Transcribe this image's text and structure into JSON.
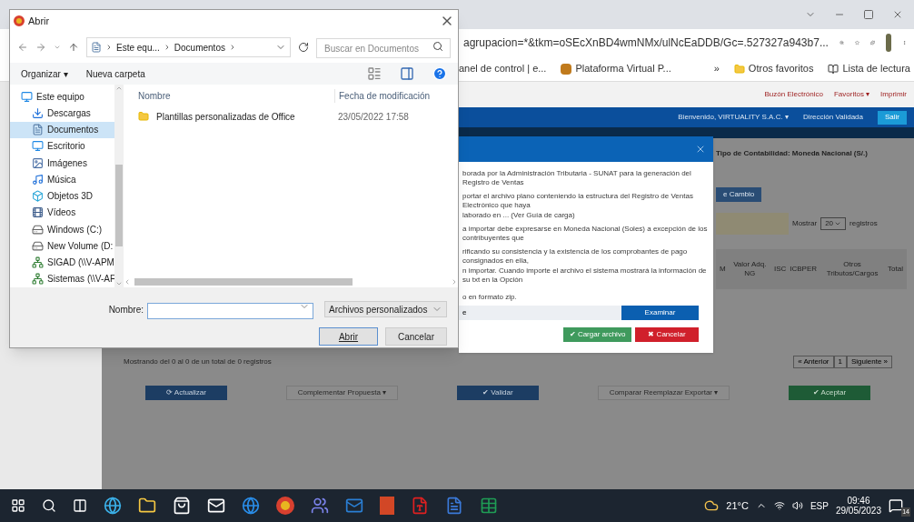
{
  "browser": {
    "address": "agrupacion=*&tkm=oSEcXnBD4wmNMx/ulNcEaDDB/Gc=.527327a943b7...",
    "bookmarks": [
      "anel de control | e...",
      "Plataforma Virtual P..."
    ],
    "more": "»",
    "other_bookmarks": "Otros favoritos",
    "reading_list": "Lista de lectura"
  },
  "page": {
    "top_links": [
      "Buzón Electrónico",
      "Favoritos ▾",
      "Imprimir"
    ],
    "user_menu": "Bienvenido, VIRTUALITY S.A.C. ▾",
    "status": "Dirección Validada",
    "logout": "Salir",
    "accounting_type": "Tipo de Contabilidad: Moneda Nacional (S/.)",
    "exchange_button": "e Cambio",
    "show_label": "Mostrar",
    "page_size": "20",
    "records_label": "registros",
    "columns": [
      "M",
      "Valor Adq. NG",
      "ISC",
      "ICBPER",
      "Otros Tributos/Cargos",
      "Total"
    ],
    "pager": {
      "prev": "« Anterior",
      "page": "1",
      "next": "Siguiente »"
    },
    "summary": "Mostrando del 0 al 0 de un total de 0 registros",
    "actions": [
      {
        "label": "⟳ Actualizar",
        "kind": "primary"
      },
      {
        "label": "Complementar Propuesta ▾",
        "kind": "dropdown"
      },
      {
        "label": "✔ Validar",
        "kind": "primary"
      },
      {
        "label": "Comparar Reemplazar Exportar ▾",
        "kind": "dropdown"
      },
      {
        "label": "✔ Aceptar",
        "kind": "success"
      }
    ]
  },
  "modal": {
    "lines": [
      "borada por la Administración Tributaria - SUNAT para la generación del Registro de Ventas",
      "portar el archivo plano conteniendo la estructura del Registro de Ventas Electrónico que haya",
      "laborado en ... (Ver Guía de carga)",
      "a importar debe expresarse en Moneda Nacional (Soles) a excepción de los contribuyentes que",
      "rificando su consistencia y la existencia de los comprobantes de pago consignados en ella,",
      "n importar. Cuando importe el archivo el sistema mostrará la información de su txt en la Opción"
    ],
    "hint": "o en formato zip.",
    "file_value": "e",
    "browse": "Examinar",
    "upload": "✔ Cargar archivo",
    "cancel": "✖ Cancelar"
  },
  "dialog": {
    "title": "Abrir",
    "breadcrumb": [
      "Este equ...",
      "Documentos"
    ],
    "search": {
      "placeholder": "Buscar en Documentos"
    },
    "organize": "Organizar ▾",
    "new_folder": "Nueva carpeta",
    "nav": [
      {
        "label": "Este equipo",
        "selected": false,
        "children": [
          {
            "label": "Descargas",
            "selected": false
          },
          {
            "label": "Documentos",
            "selected": true
          },
          {
            "label": "Escritorio",
            "selected": false
          },
          {
            "label": "Imágenes",
            "selected": false
          },
          {
            "label": "Música",
            "selected": false
          },
          {
            "label": "Objetos 3D",
            "selected": false
          },
          {
            "label": "Vídeos",
            "selected": false
          },
          {
            "label": "Windows (C:)",
            "selected": false
          },
          {
            "label": "New Volume (D:",
            "selected": false
          },
          {
            "label": "SIGAD (\\\\V-APM",
            "selected": false
          },
          {
            "label": "Sistemas (\\\\V-AF",
            "selected": false
          }
        ]
      }
    ],
    "columns": [
      "Nombre",
      "Fecha de modificación"
    ],
    "files": [
      {
        "name": "Plantillas personalizadas de Office",
        "modified": "23/05/2022 17:58"
      }
    ],
    "filename_label": "Nombre:",
    "filter": "Archivos personalizados",
    "open": "Abrir",
    "cancel": "Cancelar"
  },
  "taskbar": {
    "temperature": "21°C",
    "language": "ESP",
    "time": "09:46",
    "date": "29/05/2023",
    "notifications": "14"
  }
}
